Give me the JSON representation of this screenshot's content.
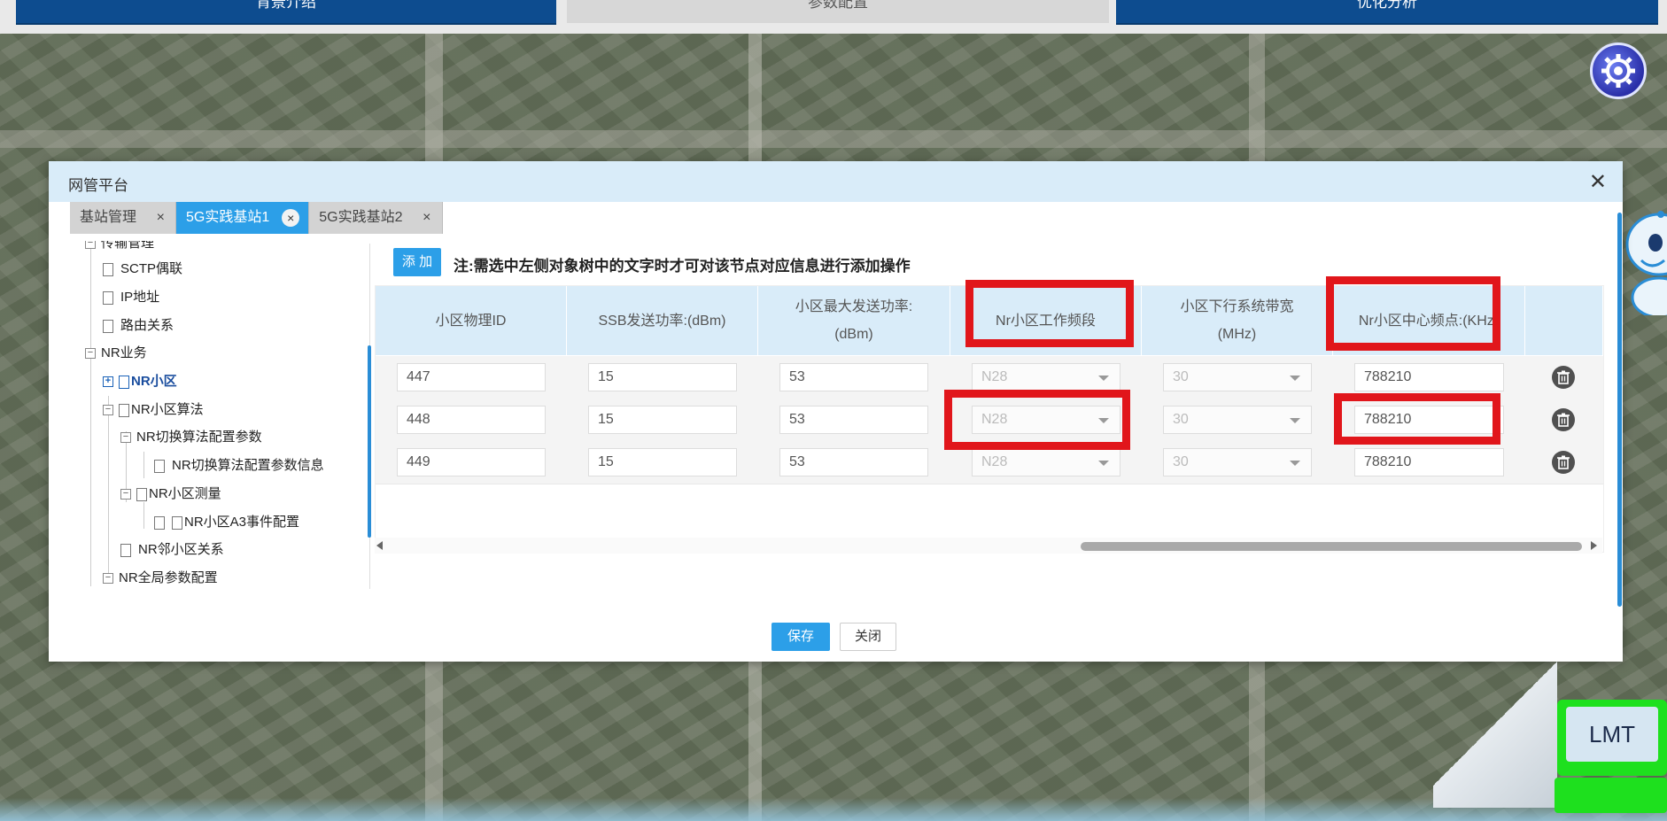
{
  "nav": {
    "items": [
      {
        "label": "背景介绍"
      },
      {
        "label": "参数配置"
      },
      {
        "label": "优化分析"
      }
    ]
  },
  "modal": {
    "title": "网管平台",
    "close_symbol": "✕",
    "tabs": [
      {
        "label": "基站管理",
        "close": "×"
      },
      {
        "label": "5G实践基站1",
        "close": "×"
      },
      {
        "label": "5G实践基站2",
        "close": "×"
      }
    ],
    "tree": {
      "nodes": [
        {
          "label": "传输管理"
        },
        {
          "label": "SCTP偶联"
        },
        {
          "label": "IP地址"
        },
        {
          "label": "路由关系"
        },
        {
          "label": "NR业务"
        },
        {
          "label": "NR小区"
        },
        {
          "label": "NR小区算法"
        },
        {
          "label": "NR切换算法配置参数"
        },
        {
          "label": "NR切换算法配置参数信息"
        },
        {
          "label": "NR小区测量"
        },
        {
          "label": "NR小区A3事件配置"
        },
        {
          "label": "NR邻小区关系"
        },
        {
          "label": "NR全局参数配置"
        }
      ],
      "toggle_minus": "−",
      "toggle_plus": "+"
    },
    "add_button": "添 加",
    "note": "注:需选中左侧对象树中的文字时才可对该节点对应信息进行添加操作",
    "table": {
      "headers": [
        {
          "l1": "小区物理ID",
          "l2": ""
        },
        {
          "l1": "SSB发送功率:(dBm)",
          "l2": ""
        },
        {
          "l1": "小区最大发送功率:",
          "l2": "(dBm)"
        },
        {
          "l1": "Nr小区工作频段",
          "l2": ""
        },
        {
          "l1": "小区下行系统带宽",
          "l2": "(MHz)"
        },
        {
          "l1": "Nr小区中心频点:(KHz)",
          "l2": ""
        }
      ],
      "rows": [
        {
          "pci": "447",
          "ssb": "15",
          "maxpower": "53",
          "band": "N28",
          "bw": "30",
          "freq": "788210"
        },
        {
          "pci": "448",
          "ssb": "15",
          "maxpower": "53",
          "band": "N28",
          "bw": "30",
          "freq": "788210"
        },
        {
          "pci": "449",
          "ssb": "15",
          "maxpower": "53",
          "band": "N28",
          "bw": "30",
          "freq": "788210"
        }
      ]
    },
    "save_button": "保存",
    "close_button": "关闭"
  },
  "lmt": {
    "label": "LMT"
  },
  "colors": {
    "primary": "#2c9fe8",
    "nav_blue": "#0d4c8f",
    "header_bg": "#d9ecf9",
    "highlight_red": "#e1161b",
    "lmt_green": "#1ee01e"
  },
  "icons": [
    "gear-icon",
    "close-icon",
    "delete-icon",
    "file-icon",
    "robot-icon",
    "lmt-computer-icon"
  ]
}
